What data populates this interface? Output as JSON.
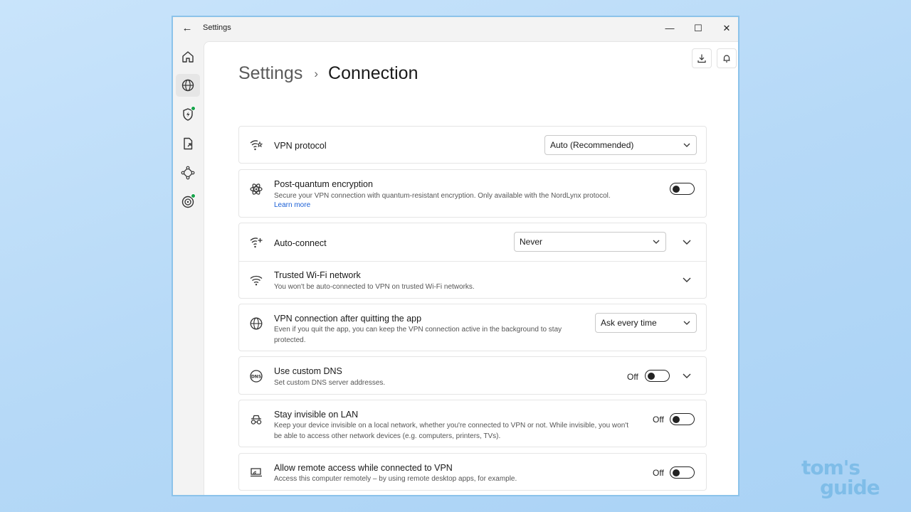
{
  "window": {
    "title": "Settings",
    "back_glyph": "←",
    "minimize_glyph": "—",
    "maximize_glyph": "☐",
    "close_glyph": "✕"
  },
  "rail": [
    {
      "name": "home-icon",
      "active": false,
      "dot": false
    },
    {
      "name": "globe-icon",
      "active": true,
      "dot": false
    },
    {
      "name": "shield-lightning-icon",
      "active": false,
      "dot": true
    },
    {
      "name": "file-share-icon",
      "active": false,
      "dot": false
    },
    {
      "name": "meshnet-icon",
      "active": false,
      "dot": false
    },
    {
      "name": "target-icon",
      "active": false,
      "dot": true
    }
  ],
  "header": {
    "root": "Settings",
    "separator": "›",
    "current": "Connection"
  },
  "rows": {
    "vpn_protocol": {
      "title": "VPN protocol",
      "select": "Auto (Recommended)"
    },
    "post_quantum": {
      "title": "Post-quantum encryption",
      "desc": "Secure your VPN connection with quantum-resistant encryption. Only available with the NordLynx protocol.",
      "link": "Learn more",
      "toggle_on": false
    },
    "auto_connect": {
      "title": "Auto-connect",
      "select": "Never"
    },
    "trusted_wifi": {
      "title": "Trusted Wi-Fi network",
      "desc": "You won't be auto-connected to VPN on trusted Wi-Fi networks."
    },
    "after_quit": {
      "title": "VPN connection after quitting the app",
      "desc": "Even if you quit the app, you can keep the VPN connection active in the background to stay protected.",
      "select": "Ask every time"
    },
    "custom_dns": {
      "title": "Use custom DNS",
      "desc": "Set custom DNS server addresses.",
      "state": "Off"
    },
    "invisible_lan": {
      "title": "Stay invisible on LAN",
      "desc": "Keep your device invisible on a local network, whether you're connected to VPN or not. While invisible, you won't be able to access other network devices (e.g. computers, printers, TVs).",
      "state": "Off"
    },
    "remote_access": {
      "title": "Allow remote access while connected to VPN",
      "desc": "Access this computer remotely – by using remote desktop apps, for example.",
      "state": "Off"
    }
  },
  "watermark": {
    "line1": "tom's",
    "line2": "guide"
  },
  "colors": {
    "accent_link": "#1a5fd6",
    "status_dot": "#16a34a",
    "window_border": "#8cc3ea"
  }
}
